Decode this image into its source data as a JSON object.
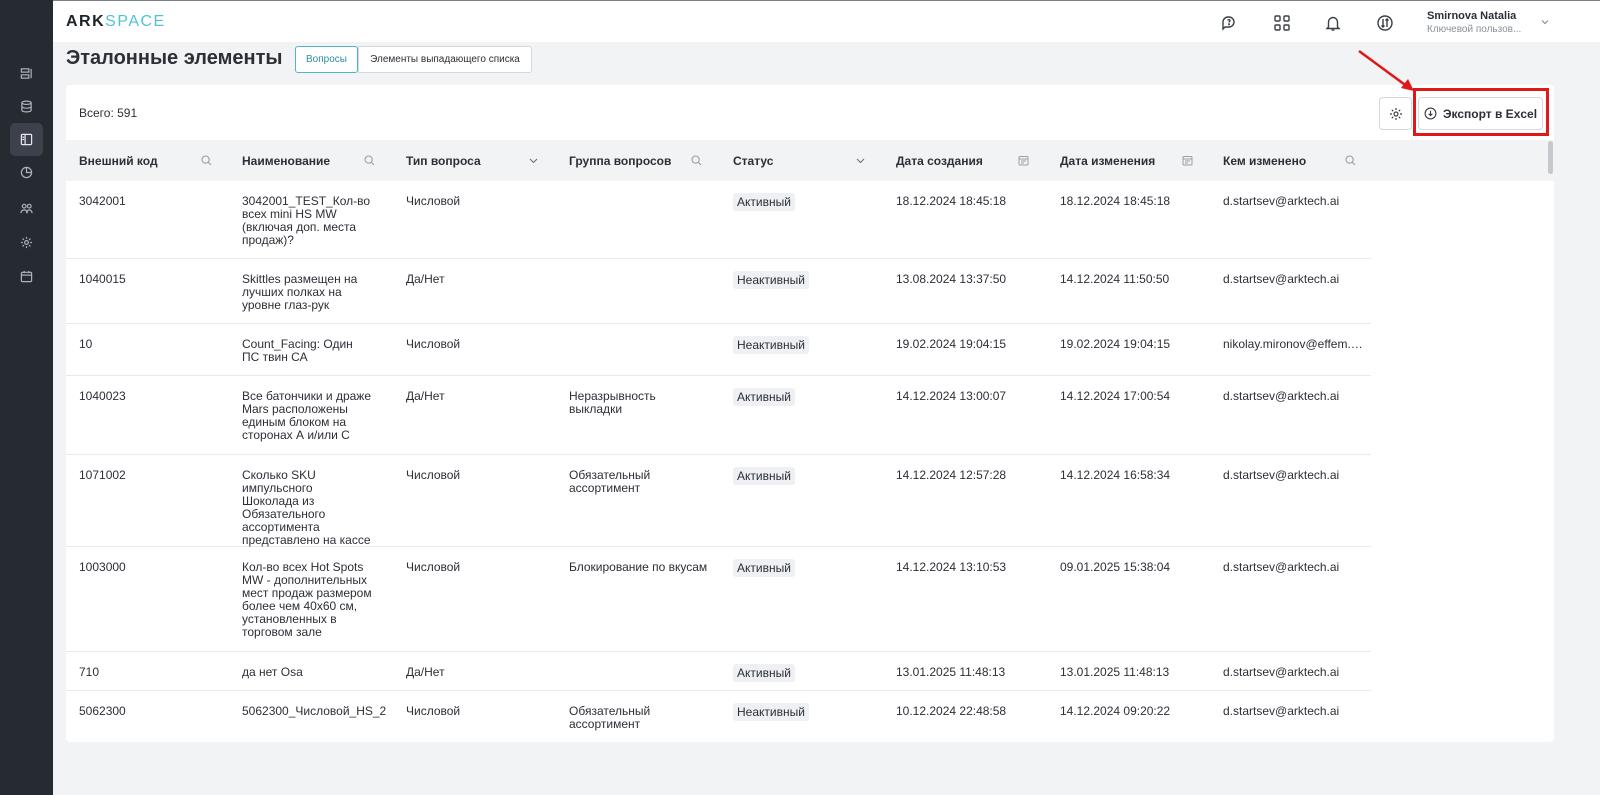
{
  "app": {
    "logo_part1": "ARK",
    "logo_part2": "SPACE"
  },
  "sidebar": {
    "items": [
      {
        "name": "reports-icon"
      },
      {
        "name": "database-icon"
      },
      {
        "name": "panel-icon",
        "active": true
      },
      {
        "name": "chart-icon"
      },
      {
        "name": "users-icon"
      },
      {
        "name": "settings-icon"
      },
      {
        "name": "calendar-icon"
      }
    ]
  },
  "user": {
    "name": "Smirnova Natalia",
    "role": "Ключевой пользов..."
  },
  "page": {
    "title": "Эталонные элементы",
    "tabs": [
      {
        "label": "Вопросы",
        "active": true
      },
      {
        "label": "Элементы выпадающего списка",
        "active": false
      }
    ]
  },
  "toolbar": {
    "total_label": "Всего: 591",
    "export_label": "Экспорт в Excel"
  },
  "table": {
    "columns": [
      {
        "label": "Внешний код",
        "icon": "search-icon"
      },
      {
        "label": "Наименование",
        "icon": "search-icon"
      },
      {
        "label": "Тип вопроса",
        "icon": "chevron-down-icon"
      },
      {
        "label": "Группа вопросов",
        "icon": "search-icon"
      },
      {
        "label": "Статус",
        "icon": "chevron-down-icon"
      },
      {
        "label": "Дата создания",
        "icon": "calendar-icon"
      },
      {
        "label": "Дата изменения",
        "icon": "calendar-icon"
      },
      {
        "label": "Кем изменено",
        "icon": "search-icon"
      }
    ],
    "rows": [
      {
        "code": "3042001",
        "name": "3042001_TEST_Кол-во всех mini HS MW (включая доп. места продаж)?",
        "type": "Числовой",
        "group": "",
        "status": "Активный",
        "created": "18.12.2024 18:45:18",
        "modified": "18.12.2024 18:45:18",
        "by": "d.startsev@arktech.ai"
      },
      {
        "code": "1040015",
        "name": "Skittles размещен на лучших полках на уровне глаз-рук",
        "type": "Да/Нет",
        "group": "",
        "status": "Неактивный",
        "created": "13.08.2024 13:37:50",
        "modified": "14.12.2024 11:50:50",
        "by": "d.startsev@arktech.ai"
      },
      {
        "code": "10",
        "name": "Count_Facing: Один ПС твин СА",
        "type": "Числовой",
        "group": "",
        "status": "Неактивный",
        "created": "19.02.2024 19:04:15",
        "modified": "19.02.2024 19:04:15",
        "by": "nikolay.mironov@effem.com"
      },
      {
        "code": "1040023",
        "name": "Все батончики и драже Mars расположены единым блоком на сторонах А и/или С",
        "type": "Да/Нет",
        "group": "Неразрывность выкладки",
        "status": "Активный",
        "created": "14.12.2024 13:00:07",
        "modified": "14.12.2024 17:00:54",
        "by": "d.startsev@arktech.ai"
      },
      {
        "code": "1071002",
        "name": "Сколько SKU импульсного Шоколада из Обязательного ассортимента представлено на кассе",
        "type": "Числовой",
        "group": "Обязательный ассортимент",
        "status": "Активный",
        "created": "14.12.2024 12:57:28",
        "modified": "14.12.2024 16:58:34",
        "by": "d.startsev@arktech.ai"
      },
      {
        "code": "1003000",
        "name": "Кол-во всех Hot Spots MW - дополнительных мест продаж размером более чем 40х60 см, установленных в торговом зале",
        "type": "Числовой",
        "group": "Блокирование по вкусам",
        "status": "Активный",
        "created": "14.12.2024 13:10:53",
        "modified": "09.01.2025 15:38:04",
        "by": "d.startsev@arktech.ai"
      },
      {
        "code": "710",
        "name": "да нет Osa",
        "type": "Да/Нет",
        "group": "",
        "status": "Активный",
        "created": "13.01.2025 11:48:13",
        "modified": "13.01.2025 11:48:13",
        "by": "d.startsev@arktech.ai"
      },
      {
        "code": "5062300",
        "name": "5062300_Числовой_HS_2",
        "type": "Числовой",
        "group": "Обязательный ассортимент",
        "status": "Неактивный",
        "created": "10.12.2024 22:48:58",
        "modified": "14.12.2024 09:20:22",
        "by": "d.startsev@arktech.ai"
      }
    ]
  },
  "colors": {
    "accent": "#4fb6c6",
    "sidebar": "#262a31",
    "highlight": "#e01818"
  }
}
